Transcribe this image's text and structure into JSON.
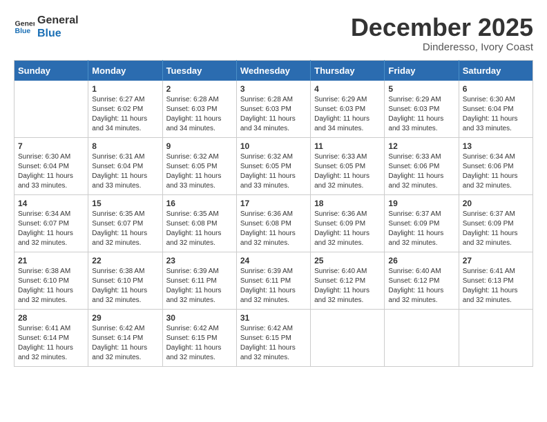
{
  "header": {
    "logo_line1": "General",
    "logo_line2": "Blue",
    "month_title": "December 2025",
    "location": "Dinderesso, Ivory Coast"
  },
  "weekdays": [
    "Sunday",
    "Monday",
    "Tuesday",
    "Wednesday",
    "Thursday",
    "Friday",
    "Saturday"
  ],
  "weeks": [
    [
      {
        "day": "",
        "info": ""
      },
      {
        "day": "1",
        "info": "Sunrise: 6:27 AM\nSunset: 6:02 PM\nDaylight: 11 hours\nand 34 minutes."
      },
      {
        "day": "2",
        "info": "Sunrise: 6:28 AM\nSunset: 6:03 PM\nDaylight: 11 hours\nand 34 minutes."
      },
      {
        "day": "3",
        "info": "Sunrise: 6:28 AM\nSunset: 6:03 PM\nDaylight: 11 hours\nand 34 minutes."
      },
      {
        "day": "4",
        "info": "Sunrise: 6:29 AM\nSunset: 6:03 PM\nDaylight: 11 hours\nand 34 minutes."
      },
      {
        "day": "5",
        "info": "Sunrise: 6:29 AM\nSunset: 6:03 PM\nDaylight: 11 hours\nand 33 minutes."
      },
      {
        "day": "6",
        "info": "Sunrise: 6:30 AM\nSunset: 6:04 PM\nDaylight: 11 hours\nand 33 minutes."
      }
    ],
    [
      {
        "day": "7",
        "info": "Sunrise: 6:30 AM\nSunset: 6:04 PM\nDaylight: 11 hours\nand 33 minutes."
      },
      {
        "day": "8",
        "info": "Sunrise: 6:31 AM\nSunset: 6:04 PM\nDaylight: 11 hours\nand 33 minutes."
      },
      {
        "day": "9",
        "info": "Sunrise: 6:32 AM\nSunset: 6:05 PM\nDaylight: 11 hours\nand 33 minutes."
      },
      {
        "day": "10",
        "info": "Sunrise: 6:32 AM\nSunset: 6:05 PM\nDaylight: 11 hours\nand 33 minutes."
      },
      {
        "day": "11",
        "info": "Sunrise: 6:33 AM\nSunset: 6:05 PM\nDaylight: 11 hours\nand 32 minutes."
      },
      {
        "day": "12",
        "info": "Sunrise: 6:33 AM\nSunset: 6:06 PM\nDaylight: 11 hours\nand 32 minutes."
      },
      {
        "day": "13",
        "info": "Sunrise: 6:34 AM\nSunset: 6:06 PM\nDaylight: 11 hours\nand 32 minutes."
      }
    ],
    [
      {
        "day": "14",
        "info": "Sunrise: 6:34 AM\nSunset: 6:07 PM\nDaylight: 11 hours\nand 32 minutes."
      },
      {
        "day": "15",
        "info": "Sunrise: 6:35 AM\nSunset: 6:07 PM\nDaylight: 11 hours\nand 32 minutes."
      },
      {
        "day": "16",
        "info": "Sunrise: 6:35 AM\nSunset: 6:08 PM\nDaylight: 11 hours\nand 32 minutes."
      },
      {
        "day": "17",
        "info": "Sunrise: 6:36 AM\nSunset: 6:08 PM\nDaylight: 11 hours\nand 32 minutes."
      },
      {
        "day": "18",
        "info": "Sunrise: 6:36 AM\nSunset: 6:09 PM\nDaylight: 11 hours\nand 32 minutes."
      },
      {
        "day": "19",
        "info": "Sunrise: 6:37 AM\nSunset: 6:09 PM\nDaylight: 11 hours\nand 32 minutes."
      },
      {
        "day": "20",
        "info": "Sunrise: 6:37 AM\nSunset: 6:09 PM\nDaylight: 11 hours\nand 32 minutes."
      }
    ],
    [
      {
        "day": "21",
        "info": "Sunrise: 6:38 AM\nSunset: 6:10 PM\nDaylight: 11 hours\nand 32 minutes."
      },
      {
        "day": "22",
        "info": "Sunrise: 6:38 AM\nSunset: 6:10 PM\nDaylight: 11 hours\nand 32 minutes."
      },
      {
        "day": "23",
        "info": "Sunrise: 6:39 AM\nSunset: 6:11 PM\nDaylight: 11 hours\nand 32 minutes."
      },
      {
        "day": "24",
        "info": "Sunrise: 6:39 AM\nSunset: 6:11 PM\nDaylight: 11 hours\nand 32 minutes."
      },
      {
        "day": "25",
        "info": "Sunrise: 6:40 AM\nSunset: 6:12 PM\nDaylight: 11 hours\nand 32 minutes."
      },
      {
        "day": "26",
        "info": "Sunrise: 6:40 AM\nSunset: 6:12 PM\nDaylight: 11 hours\nand 32 minutes."
      },
      {
        "day": "27",
        "info": "Sunrise: 6:41 AM\nSunset: 6:13 PM\nDaylight: 11 hours\nand 32 minutes."
      }
    ],
    [
      {
        "day": "28",
        "info": "Sunrise: 6:41 AM\nSunset: 6:14 PM\nDaylight: 11 hours\nand 32 minutes."
      },
      {
        "day": "29",
        "info": "Sunrise: 6:42 AM\nSunset: 6:14 PM\nDaylight: 11 hours\nand 32 minutes."
      },
      {
        "day": "30",
        "info": "Sunrise: 6:42 AM\nSunset: 6:15 PM\nDaylight: 11 hours\nand 32 minutes."
      },
      {
        "day": "31",
        "info": "Sunrise: 6:42 AM\nSunset: 6:15 PM\nDaylight: 11 hours\nand 32 minutes."
      },
      {
        "day": "",
        "info": ""
      },
      {
        "day": "",
        "info": ""
      },
      {
        "day": "",
        "info": ""
      }
    ]
  ]
}
